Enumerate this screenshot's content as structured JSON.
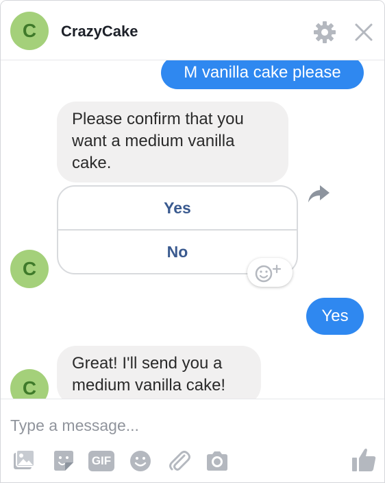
{
  "header": {
    "avatar_letter": "C",
    "title": "CrazyCake",
    "settings_icon": "gear-icon",
    "close_icon": "close-icon"
  },
  "messages": {
    "out_1": "M vanilla cake please",
    "in_1": "Please confirm that you want a medium vanilla cake.",
    "quick_replies": [
      "Yes",
      "No"
    ],
    "bot_avatar_letter": "C",
    "out_2": "Yes",
    "in_2": "Great! I'll send you a medium vanilla cake!"
  },
  "composer": {
    "placeholder": "Type a message...",
    "tools": [
      "photo-icon",
      "sticker-icon",
      "gif-icon",
      "emoji-icon",
      "attachment-icon",
      "camera-icon",
      "thumbs-up-icon"
    ],
    "gif_label": "GIF"
  },
  "colors": {
    "accent": "#2f88f0",
    "avatar_bg": "#a4d07a",
    "quick_reply_text": "#3a5a8f",
    "icon_gray": "#b4b8bf"
  }
}
